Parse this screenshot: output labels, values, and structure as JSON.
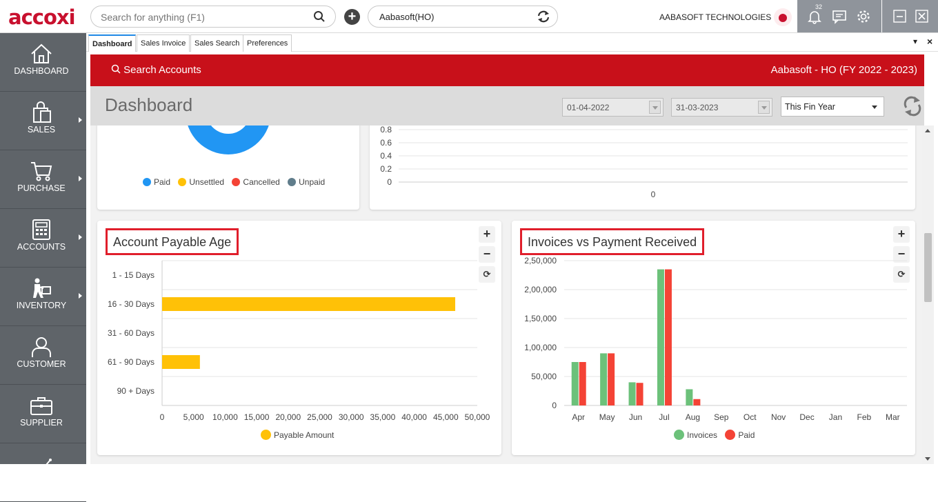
{
  "app": {
    "logo": "accoxi"
  },
  "search": {
    "placeholder": "Search for anything (F1)"
  },
  "branch": {
    "label": "Aabasoft(HO)"
  },
  "company": {
    "name": "AABASOFT TECHNOLOGIES"
  },
  "notifications": {
    "count": "32"
  },
  "sidebar": {
    "items": [
      {
        "label": "DASHBOARD",
        "icon": "home-icon",
        "has_submenu": false
      },
      {
        "label": "SALES",
        "icon": "shopping-bag-icon",
        "has_submenu": true
      },
      {
        "label": "PURCHASE",
        "icon": "cart-icon",
        "has_submenu": true
      },
      {
        "label": "ACCOUNTS",
        "icon": "calculator-icon",
        "has_submenu": true
      },
      {
        "label": "INVENTORY",
        "icon": "worker-box-icon",
        "has_submenu": true
      },
      {
        "label": "CUSTOMER",
        "icon": "person-icon",
        "has_submenu": false
      },
      {
        "label": "SUPPLIER",
        "icon": "briefcase-icon",
        "has_submenu": false
      },
      {
        "label": "",
        "icon": "chart-line-icon",
        "has_submenu": false
      }
    ]
  },
  "tabs": [
    {
      "label": "Dashboard",
      "active": true
    },
    {
      "label": "Sales Invoice",
      "active": false
    },
    {
      "label": "Sales Search",
      "active": false
    },
    {
      "label": "Preferences",
      "active": false
    }
  ],
  "header": {
    "search_accounts": "Search Accounts",
    "company_period": "Aabasoft - HO (FY 2022 - 2023)"
  },
  "dashboard": {
    "title": "Dashboard",
    "from_date": "01-04-2022",
    "to_date": "31-03-2023",
    "period": "This Fin Year"
  },
  "colors": {
    "brand_red": "#c8101a",
    "highlight_red": "#e01e2b",
    "paid": "#2196f3",
    "unsettled": "#ffc107",
    "cancelled": "#f44336",
    "unpaid": "#607d8b",
    "payable": "#ffc107",
    "invoices": "#6cc17a",
    "paid_bar": "#f44336"
  },
  "top_left_card": {
    "legend": [
      {
        "label": "Paid",
        "color": "#2196f3"
      },
      {
        "label": "Unsettled",
        "color": "#ffc107"
      },
      {
        "label": "Cancelled",
        "color": "#f44336"
      },
      {
        "label": "Unpaid",
        "color": "#607d8b"
      }
    ]
  },
  "top_right_card": {
    "y_ticks": [
      "0.8",
      "0.6",
      "0.4",
      "0.2",
      "0"
    ],
    "x_label": "0"
  },
  "payable_age_card": {
    "title": "Account Payable Age",
    "legend": "Payable Amount"
  },
  "invoices_card": {
    "title": "Invoices vs Payment Received",
    "legend_invoices": "Invoices",
    "legend_paid": "Paid"
  },
  "chart_data": [
    {
      "type": "bar",
      "orientation": "horizontal",
      "title": "Account Payable Age",
      "categories": [
        "1 - 15 Days",
        "16 - 30 Days",
        "31 - 60 Days",
        "61 - 90 Days",
        "90 + Days"
      ],
      "series": [
        {
          "name": "Payable Amount",
          "values": [
            0,
            46500,
            0,
            6000,
            0
          ]
        }
      ],
      "x_ticks": [
        "0",
        "5,000",
        "10,000",
        "15,000",
        "20,000",
        "25,000",
        "30,000",
        "35,000",
        "40,000",
        "45,000",
        "50,000"
      ],
      "xlim": [
        0,
        50000
      ],
      "legend": "bottom"
    },
    {
      "type": "bar",
      "title": "Invoices vs Payment Received",
      "categories": [
        "Apr",
        "May",
        "Jun",
        "Jul",
        "Aug",
        "Sep",
        "Oct",
        "Nov",
        "Dec",
        "Jan",
        "Feb",
        "Mar"
      ],
      "series": [
        {
          "name": "Invoices",
          "values": [
            75000,
            90000,
            40000,
            235000,
            28000,
            0,
            0,
            0,
            0,
            0,
            0,
            0
          ]
        },
        {
          "name": "Paid",
          "values": [
            75000,
            90000,
            39000,
            235000,
            11000,
            0,
            0,
            0,
            0,
            0,
            0,
            0
          ]
        }
      ],
      "y_ticks": [
        "2,50,000",
        "2,00,000",
        "1,50,000",
        "1,00,000",
        "50,000",
        "0"
      ],
      "ylim": [
        0,
        250000
      ],
      "legend": "bottom"
    }
  ]
}
